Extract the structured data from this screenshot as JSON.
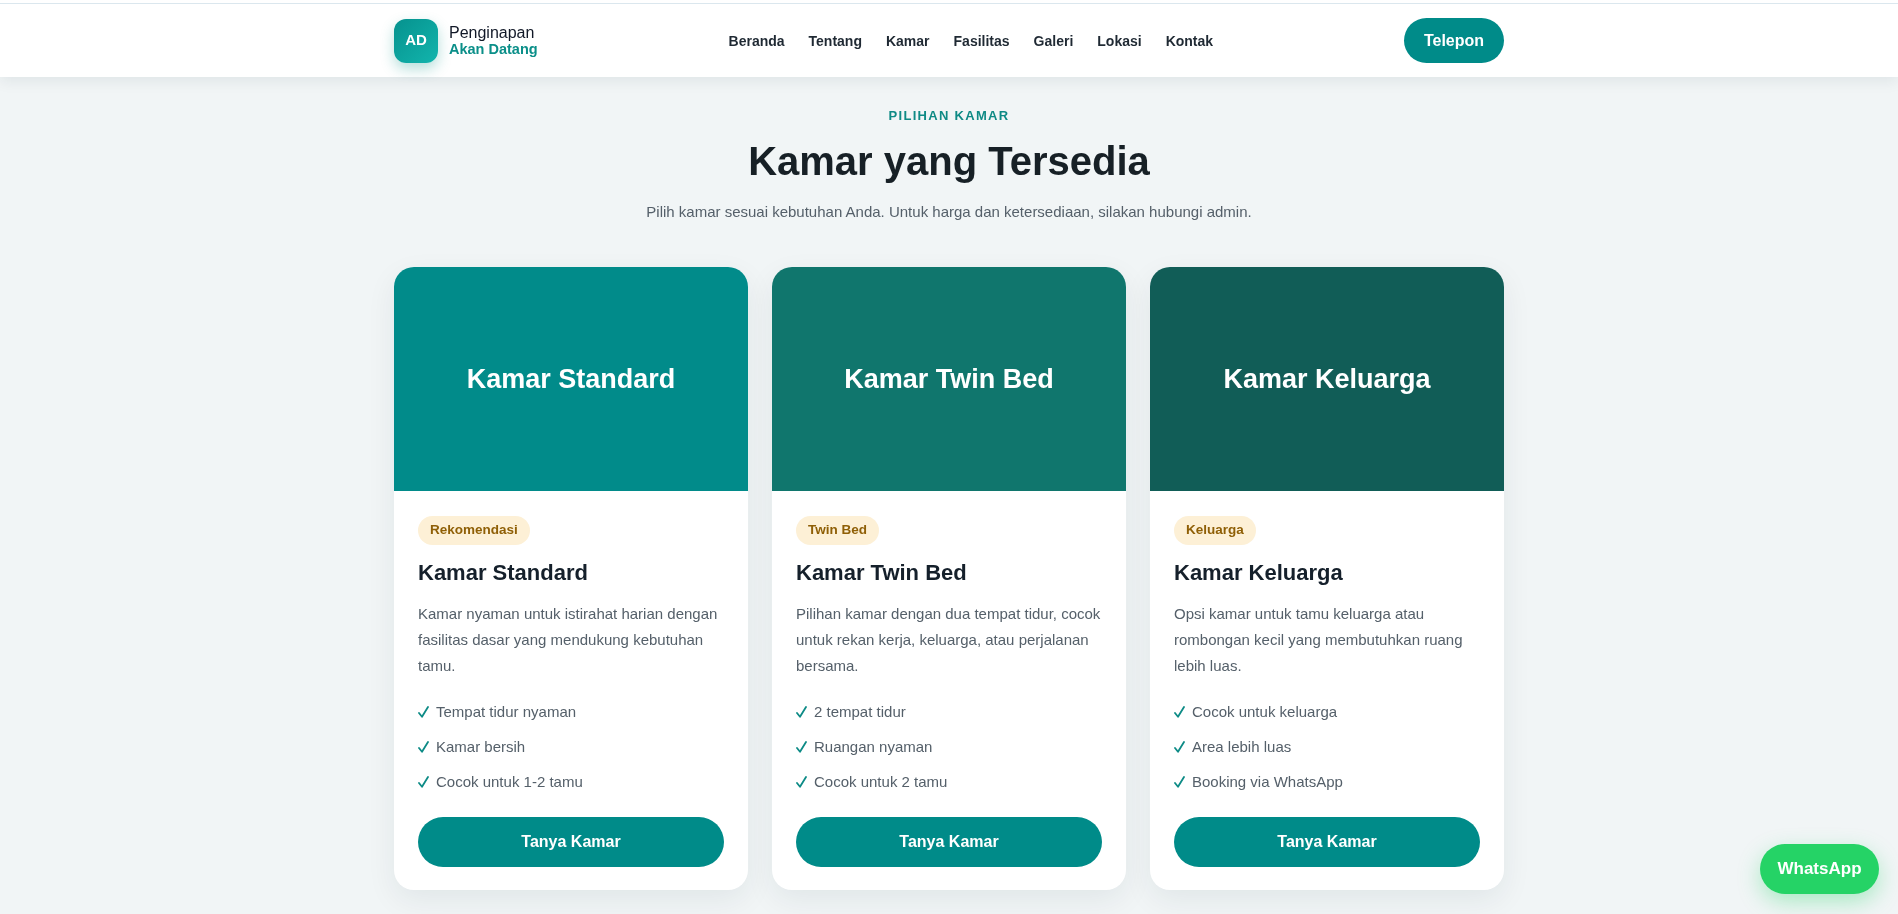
{
  "header": {
    "logo": {
      "initials": "AD",
      "name": "Penginapan",
      "tagline": "Akan Datang"
    },
    "nav": [
      "Beranda",
      "Tentang",
      "Kamar",
      "Fasilitas",
      "Galeri",
      "Lokasi",
      "Kontak"
    ],
    "cta": "Telepon"
  },
  "section": {
    "eyebrow": "PILIHAN KAMAR",
    "title": "Kamar yang Tersedia",
    "subtitle": "Pilih kamar sesuai kebutuhan Anda. Untuk harga dan ketersediaan, silakan hubungi admin."
  },
  "rooms": [
    {
      "banner_title": "Kamar Standard",
      "color": "#018b8a",
      "badge": "Rekomendasi",
      "title": "Kamar Standard",
      "description": "Kamar nyaman untuk istirahat harian dengan fasilitas dasar yang mendukung kebutuhan tamu.",
      "features": [
        "Tempat tidur nyaman",
        "Kamar bersih",
        "Cocok untuk 1-2 tamu"
      ],
      "button": "Tanya Kamar"
    },
    {
      "banner_title": "Kamar Twin Bed",
      "color": "#10766d",
      "badge": "Twin Bed",
      "title": "Kamar Twin Bed",
      "description": "Pilihan kamar dengan dua tempat tidur, cocok untuk rekan kerja, keluarga, atau perjalanan bersama.",
      "features": [
        "2 tempat tidur",
        "Ruangan nyaman",
        "Cocok untuk 2 tamu"
      ],
      "button": "Tanya Kamar"
    },
    {
      "banner_title": "Kamar Keluarga",
      "color": "#115d57",
      "badge": "Keluarga",
      "title": "Kamar Keluarga",
      "description": "Opsi kamar untuk tamu keluarga atau rombongan kecil yang membutuhkan ruang lebih luas.",
      "features": [
        "Cocok untuk keluarga",
        "Area lebih luas",
        "Booking via WhatsApp"
      ],
      "button": "Tanya Kamar"
    }
  ],
  "floating_button": "WhatsApp"
}
